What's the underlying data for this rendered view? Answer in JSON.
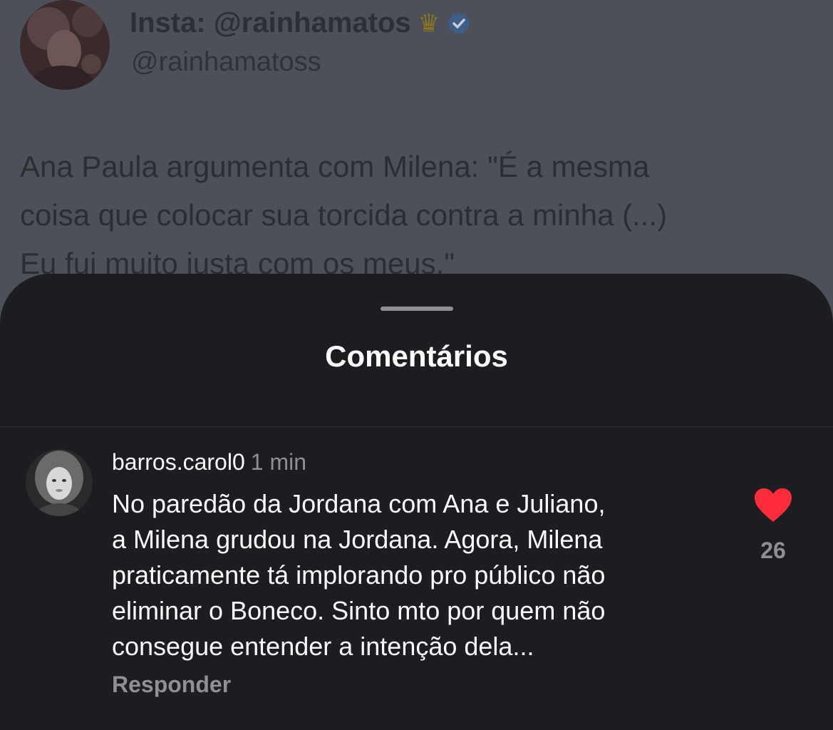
{
  "tweet": {
    "display_name": "Insta: @rainhamatos",
    "crown_glyph": "♛",
    "handle": "@rainhamatoss",
    "text_lines": [
      "Ana Paula argumenta com Milena: \"É a mesma",
      "coisa que colocar sua torcida contra a minha (...)",
      "Eu fui muito justa com os meus.\""
    ]
  },
  "sheet": {
    "title": "Comentários"
  },
  "comment": {
    "username": "barros.carol0",
    "time": "1 min",
    "text_lines": [
      "No paredão da Jordana com Ana e Juliano,",
      "a Milena grudou na Jordana. Agora, Milena",
      "praticamente tá implorando pro público não",
      "eliminar o Boneco. Sinto mto por quem não",
      "consegue entender a intenção dela..."
    ],
    "reply_label": "Responder",
    "likes": "26",
    "liked": true
  },
  "colors": {
    "like_red": "#ff2a3a",
    "verified_blue": "#3d5e86",
    "sheet_bg": "#1b1d21"
  }
}
